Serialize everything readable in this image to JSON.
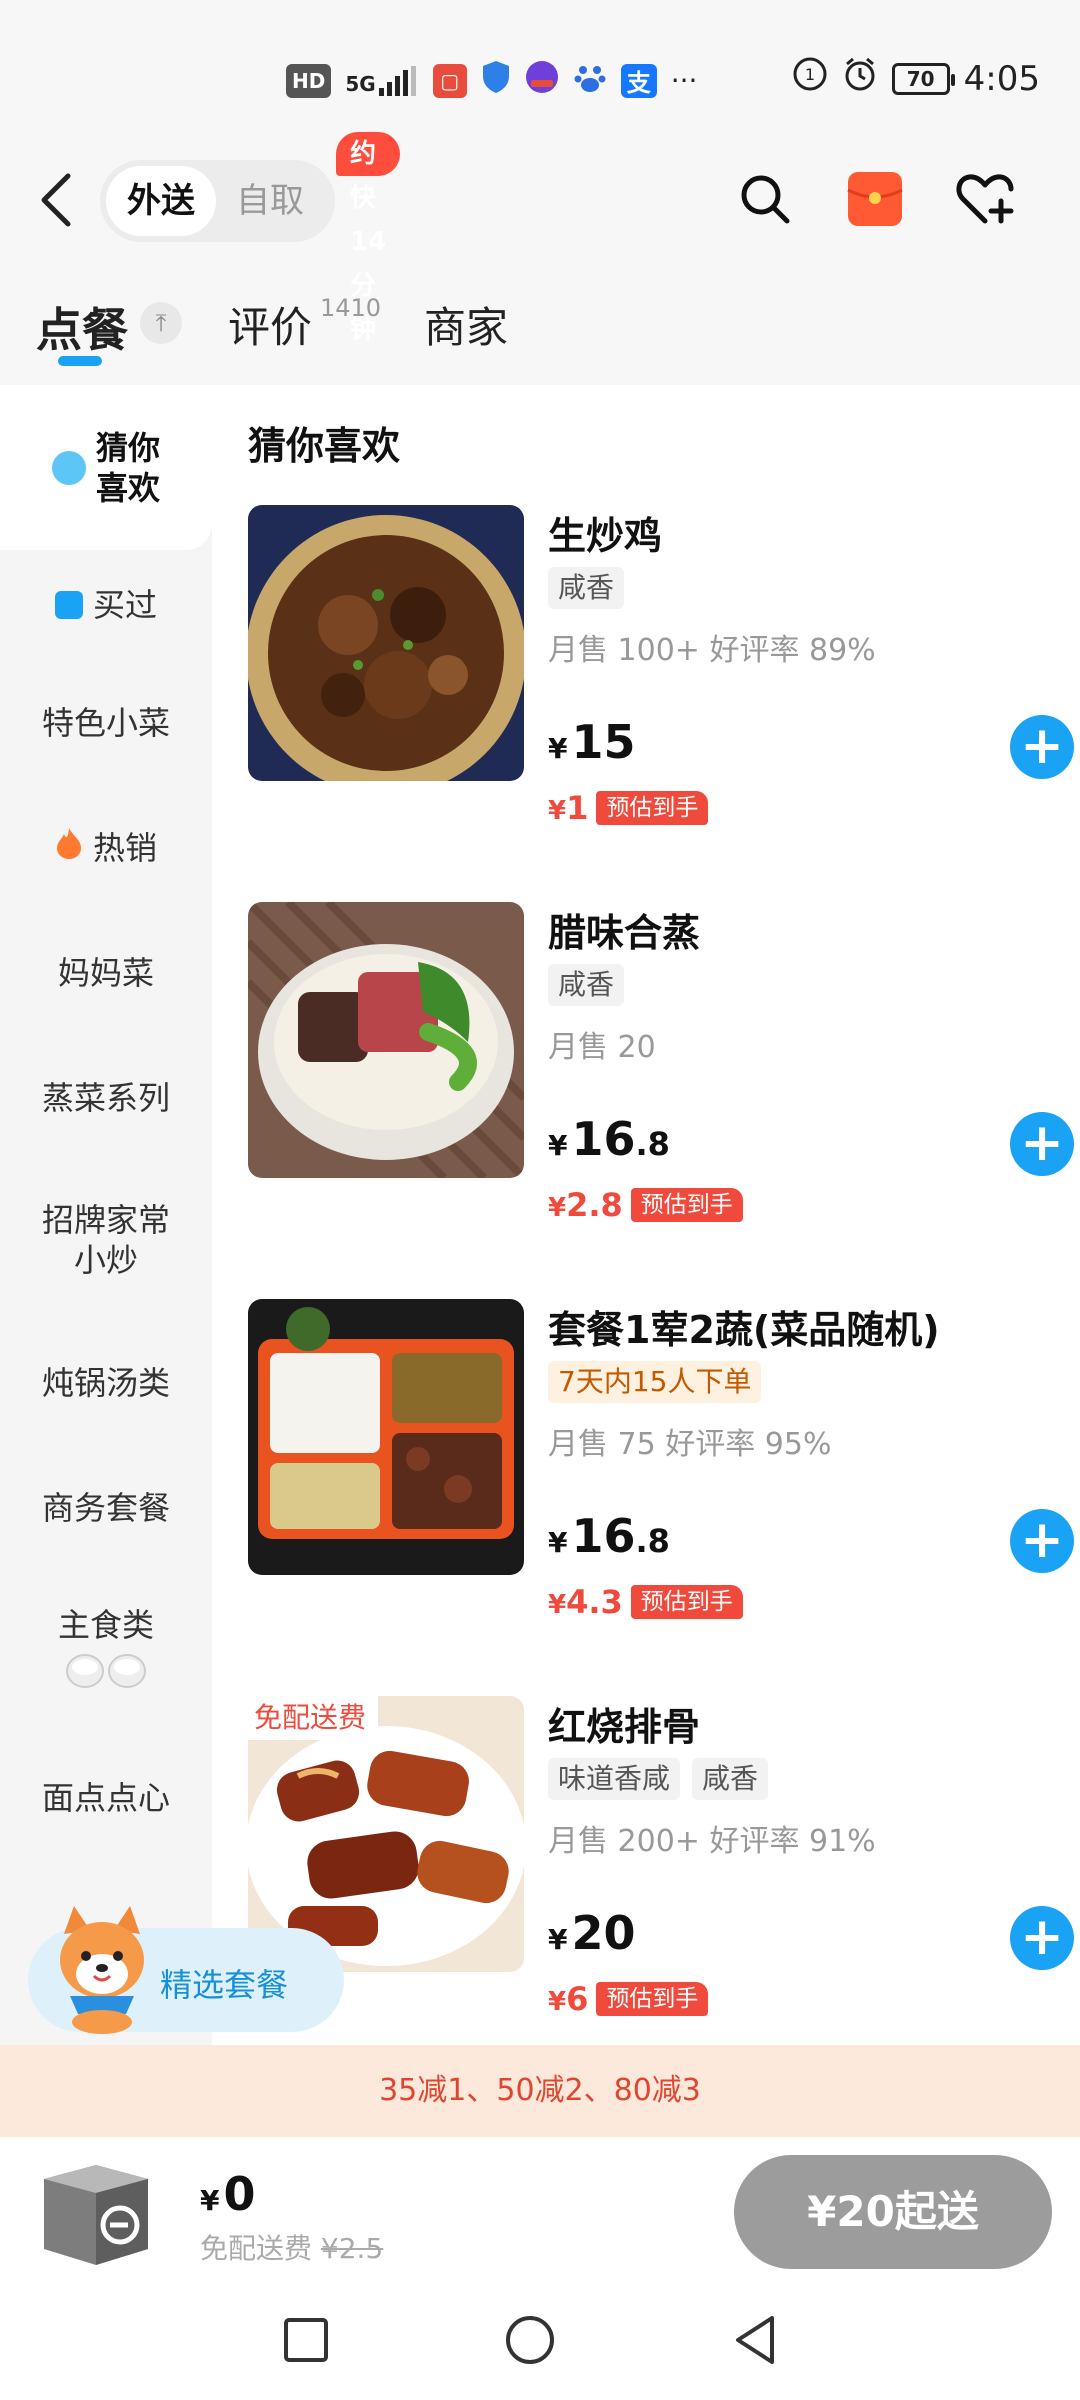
{
  "status_bar": {
    "left_icons": [
      "HD",
      "5G",
      "huawei-app",
      "shield-app",
      "app-icon",
      "baidu-app",
      "alipay-app",
      "more-dots"
    ],
    "battery": "70",
    "time": "4:05",
    "hd_label": "HD",
    "signal_label": "5G"
  },
  "header": {
    "mode_active": "外送",
    "mode_inactive": "自取",
    "faster_badge": "约快14分钟",
    "icons": [
      "back-icon",
      "search-icon",
      "red-packet-icon",
      "favorite-add-icon"
    ]
  },
  "tabs": {
    "order": "点餐",
    "reviews": "评价",
    "reviews_count": "1410",
    "merchant": "商家",
    "accent_color": "#1aa3f5"
  },
  "sidebar": {
    "items": [
      {
        "label": "猜你\n喜欢"
      },
      {
        "label": "买过"
      },
      {
        "label": "特色小菜"
      },
      {
        "label": "热销"
      },
      {
        "label": "妈妈菜"
      },
      {
        "label": "蒸菜系列"
      },
      {
        "label": "招牌家常\n小炒"
      },
      {
        "label": "炖锅汤类"
      },
      {
        "label": "商务套餐"
      },
      {
        "label": "主食类"
      },
      {
        "label": "面点点心"
      }
    ]
  },
  "main": {
    "section_title": "猜你喜欢",
    "dishes": [
      {
        "name": "生炒鸡",
        "tags": [
          "咸香"
        ],
        "sales": "月售 100+ 好评率 89%",
        "price_yen": "¥",
        "price_int": "15",
        "price_dec": "",
        "est_yen": "¥",
        "est_value": "1",
        "est_label": "预估到手"
      },
      {
        "name": "腊味合蒸",
        "tags": [
          "咸香"
        ],
        "sales": "月售 20",
        "price_yen": "¥",
        "price_int": "16",
        "price_dec": ".8",
        "est_yen": "¥",
        "est_value": "2.8",
        "est_label": "预估到手"
      },
      {
        "name": "套餐1荤2蔬(菜品随机)",
        "tags": [
          "7天内15人下单"
        ],
        "sales": "月售 75 好评率 95%",
        "price_yen": "¥",
        "price_int": "16",
        "price_dec": ".8",
        "est_yen": "¥",
        "est_value": "4.3",
        "est_label": "预估到手"
      },
      {
        "name": "红烧排骨",
        "tags": [
          "味道香咸",
          "咸香"
        ],
        "sales": "月售 200+ 好评率 91%",
        "price_yen": "¥",
        "price_int": "20",
        "price_dec": "",
        "est_yen": "¥",
        "est_value": "6",
        "est_label": "预估到手",
        "badge": "免配送费"
      }
    ]
  },
  "floating": {
    "label": "精选套餐"
  },
  "promo": {
    "text": "35减1、50减2、80减3"
  },
  "cart": {
    "yen": "¥",
    "total": "0",
    "fee_label": "免配送费",
    "fee_original": "¥2.5",
    "min_order": "¥20起送"
  },
  "nav": {
    "icons": [
      "recent-apps-icon",
      "home-icon",
      "back-nav-icon"
    ]
  }
}
